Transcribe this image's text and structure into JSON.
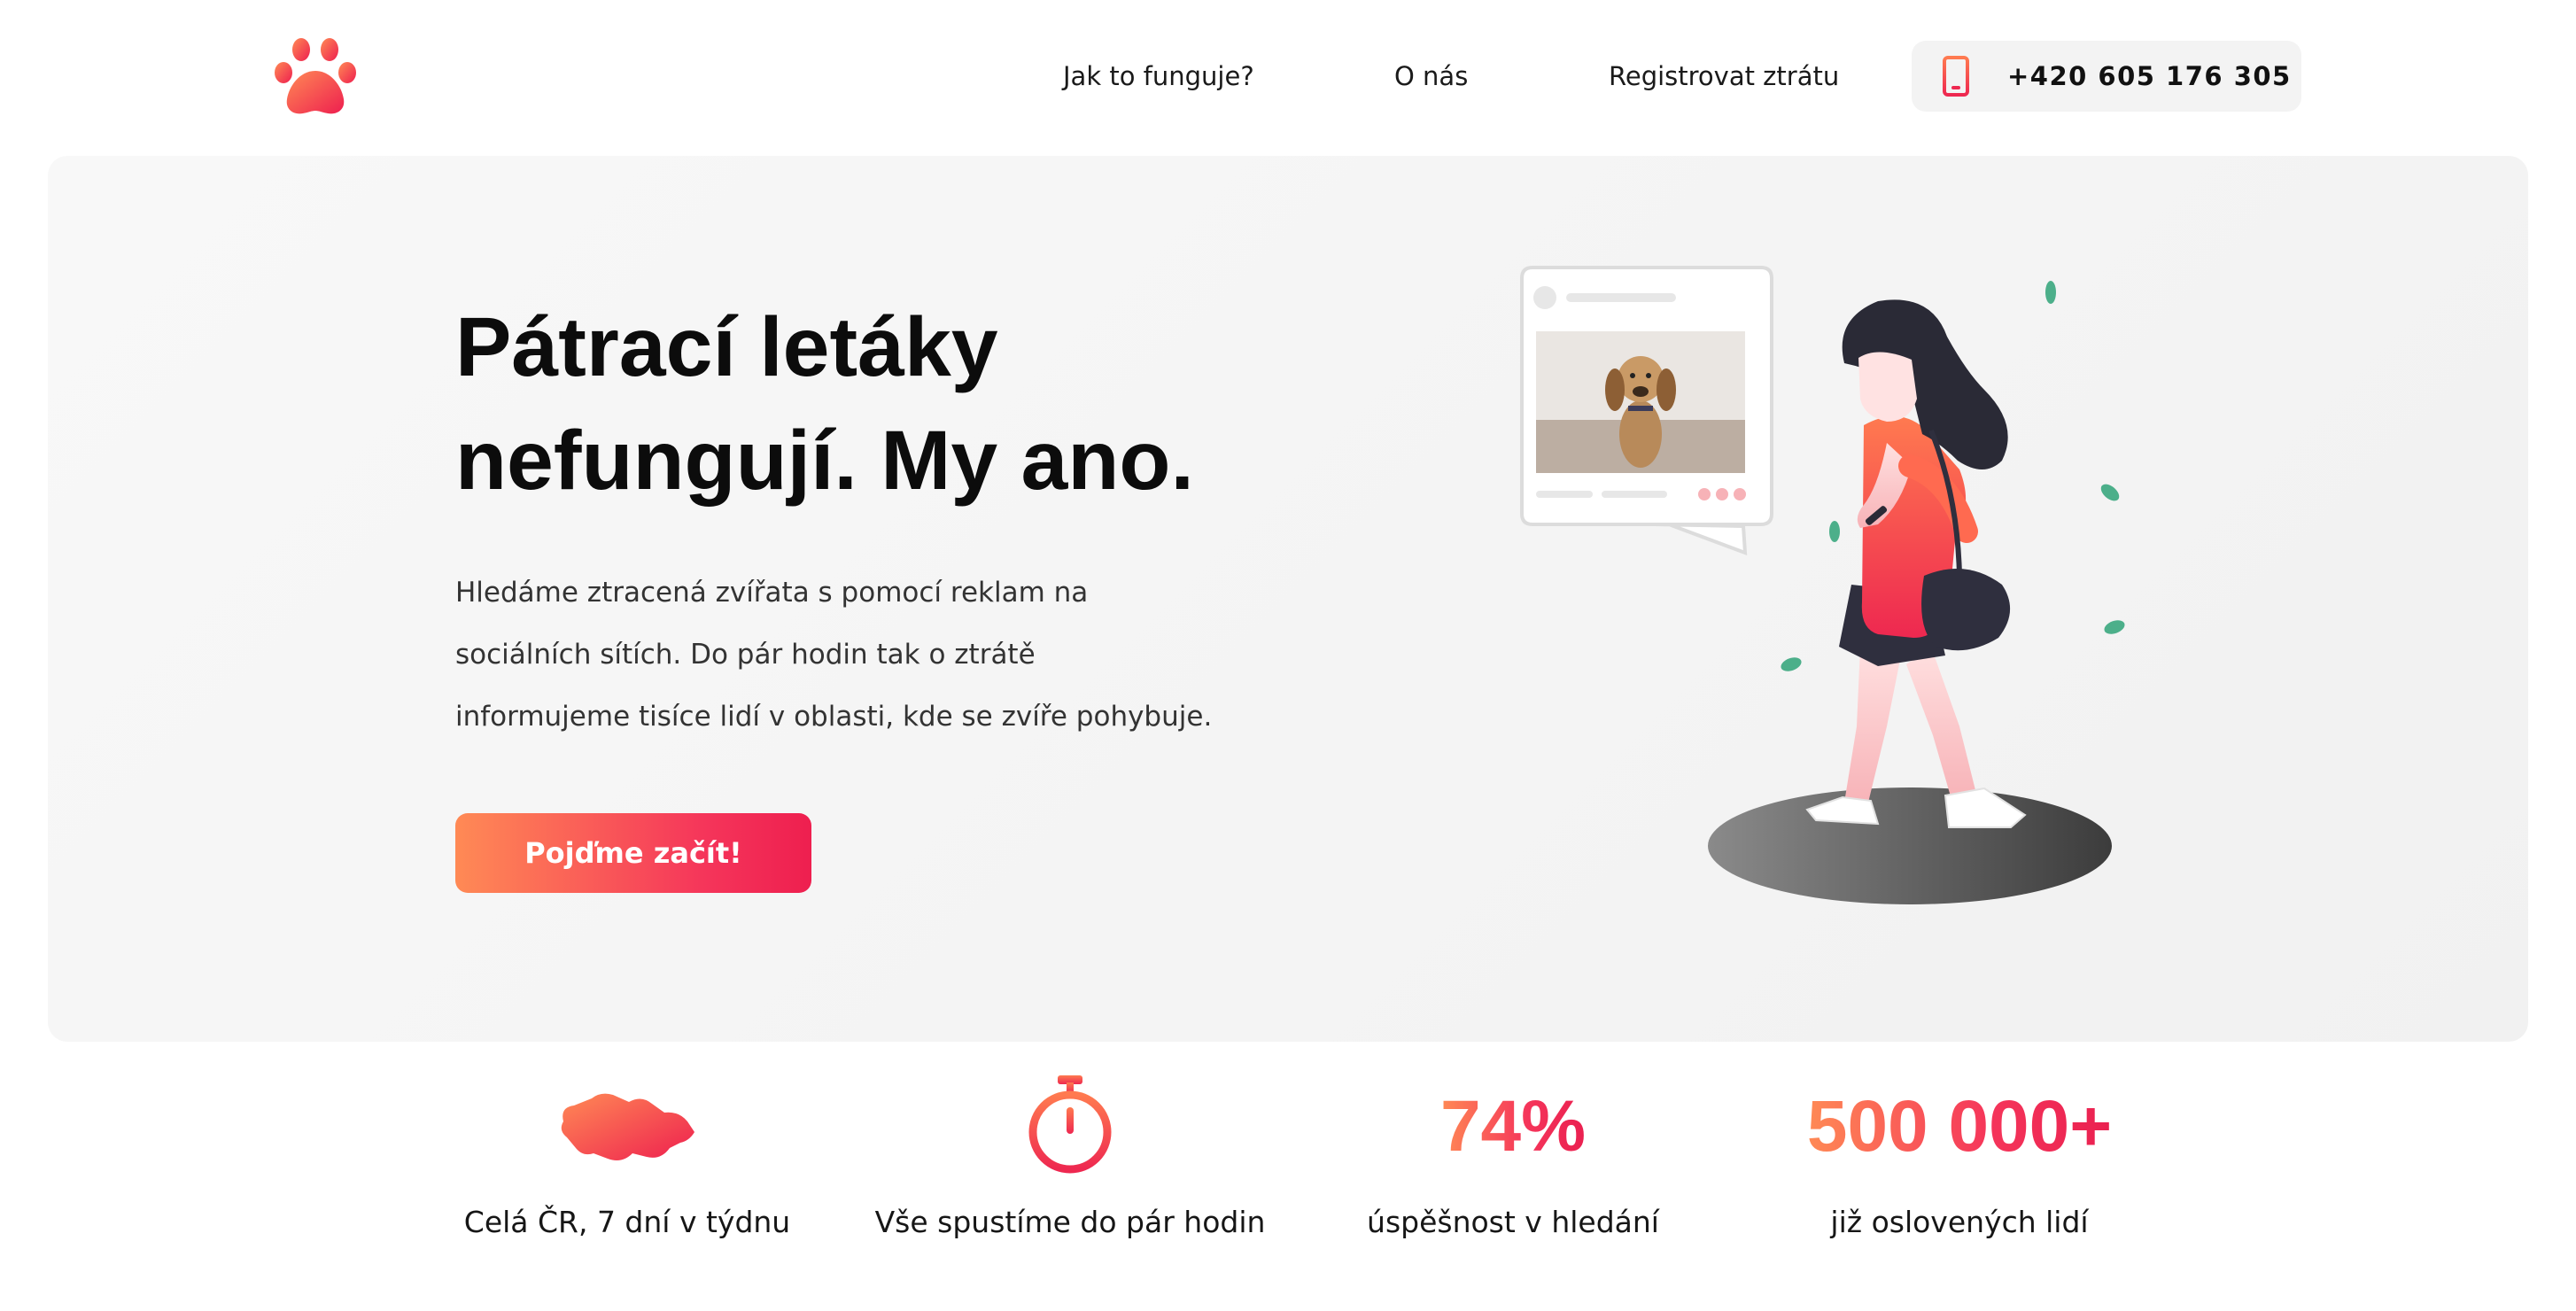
{
  "colors": {
    "accent_start": "#ff8a55",
    "accent_end": "#ee1f4f",
    "hero_background": "#f4f4f4",
    "text_dark": "#111111"
  },
  "header": {
    "logo_icon": "paw-icon",
    "nav": [
      {
        "label": "Jak to funguje?"
      },
      {
        "label": "O nás"
      },
      {
        "label": "Registrovat ztrátu"
      }
    ],
    "phone": {
      "icon": "phone-icon",
      "number": "+420 605 176 305"
    }
  },
  "hero": {
    "title_line1": "Pátrací letáky",
    "title_line2": "nefungují. My ano.",
    "description_lines": [
      "Hledáme ztracená zvířata s pomocí reklam na",
      "sociálních sítích. Do pár hodin tak o ztrátě",
      "informujeme tisíce lidí v oblasti, kde se zvíře pohybuje."
    ],
    "cta_label": "Pojďme začít!",
    "illustration": "woman-walking-with-phone-and-lost-dog-post-illustration"
  },
  "stats": [
    {
      "icon": "czech-map-icon",
      "label": "Celá ČR, 7 dní v týdnu"
    },
    {
      "icon": "stopwatch-icon",
      "label": "Vše spustíme do pár hodin"
    },
    {
      "number": "74%",
      "label": "úspěšnost v hledání"
    },
    {
      "number": "500 000+",
      "label": "již oslovených lidí"
    }
  ]
}
